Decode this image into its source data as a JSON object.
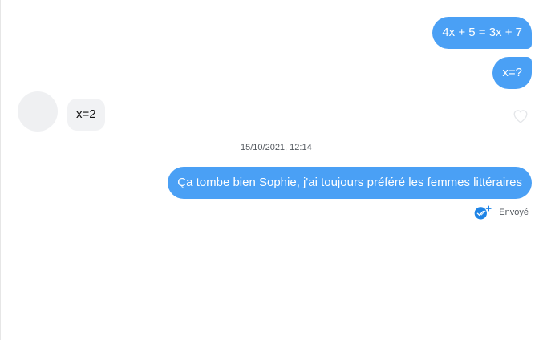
{
  "conversation": {
    "messages": [
      {
        "id": "msg-1",
        "direction": "sent",
        "text": "4x + 5 = 3x + 7"
      },
      {
        "id": "msg-2",
        "direction": "sent",
        "text": "x=?"
      },
      {
        "id": "msg-3",
        "direction": "received",
        "text": "x=2"
      },
      {
        "id": "msg-4",
        "direction": "sent",
        "text": "Ça tombe bien Sophie, j'ai toujours préféré les femmes littéraires"
      }
    ],
    "timestamp": "15/10/2021, 12:14",
    "status": {
      "label": "Envoyé",
      "icon": "sent-check-icon"
    }
  },
  "icons": {
    "like": "heart-outline-icon",
    "avatar": "avatar-placeholder"
  },
  "colors": {
    "sent_bubble": "#4aa0f5",
    "received_bubble": "#f1f2f4",
    "avatar": "#eff0f2",
    "status_check": "#1e84e6"
  }
}
